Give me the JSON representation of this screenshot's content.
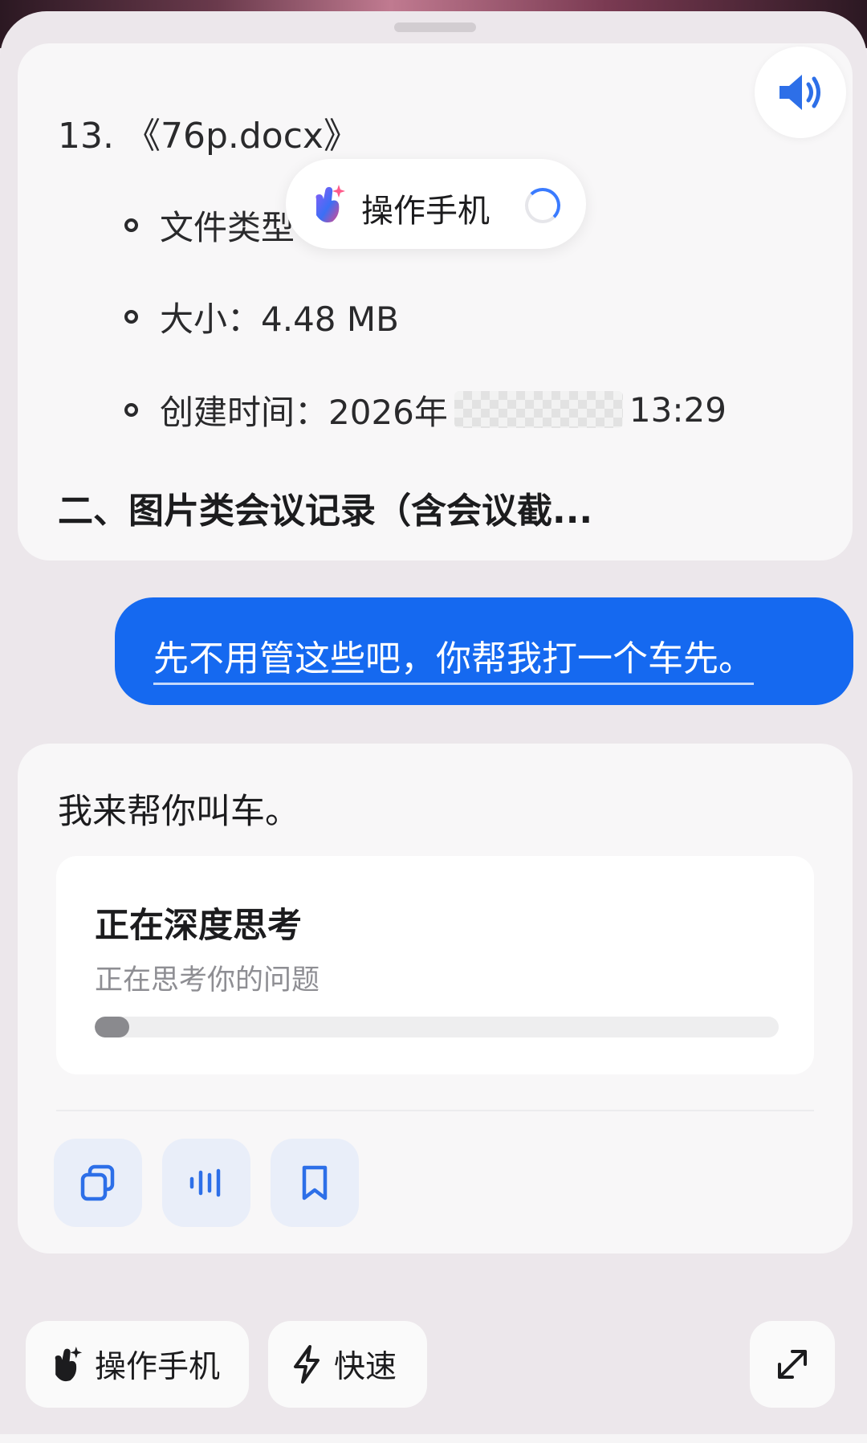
{
  "previous_message": {
    "file_title": "13. 《76p.docx》",
    "bullets": [
      {
        "label": "文件类型"
      },
      {
        "label": "大小：4.48 MB"
      },
      {
        "label_prefix": "创建时间：2026年",
        "label_suffix": "13:29"
      }
    ],
    "section_heading": "二、图片类会议记录（含会议截..."
  },
  "operate_pill": {
    "label": "操作手机",
    "icon": "magic-hand-icon"
  },
  "user_message": {
    "text": "先不用管这些吧，你帮我打一个车先。"
  },
  "assistant_reply": {
    "text": "我来帮你叫车。",
    "thinking": {
      "title": "正在深度思考",
      "subtitle": "正在思考你的问题",
      "progress": 0.05
    },
    "actions": [
      {
        "icon": "copy-icon"
      },
      {
        "icon": "voice-wave-icon"
      },
      {
        "icon": "bookmark-icon"
      }
    ]
  },
  "toolbar": {
    "operate_label": "操作手机",
    "quick_label": "快速",
    "expand_icon": "expand-icon"
  },
  "colors": {
    "accent": "#1569f0",
    "icon_blue": "#2d6fe8",
    "background": "#ece7eb"
  }
}
